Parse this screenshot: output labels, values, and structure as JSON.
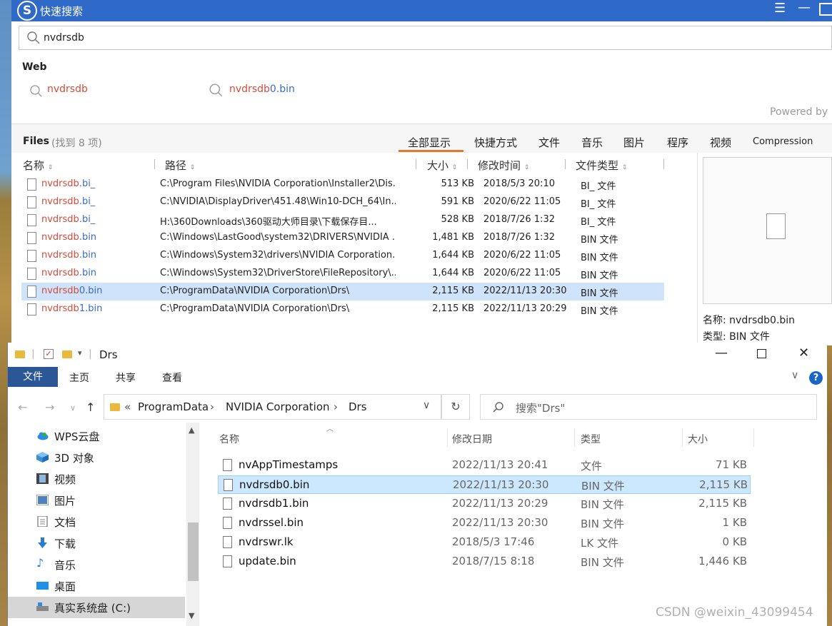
{
  "quick_search": {
    "app_title": "快速搜索",
    "logo_glyph": "S",
    "query": "nvdrsdb",
    "web_label": "Web",
    "web_suggestions": [
      {
        "red": "nvdrsdb",
        "blue": ""
      },
      {
        "red": "nvdrsdb",
        "blue": "0.bin"
      }
    ],
    "powered_by": "Powered by",
    "files_label": "Files",
    "files_count": "(找到 8 项)",
    "tabs": [
      "全部显示",
      "快捷方式",
      "文件",
      "音乐",
      "图片",
      "程序",
      "视频",
      "Compression"
    ],
    "active_tab": "全部显示",
    "columns": {
      "name": "名称",
      "path": "路径",
      "size": "大小",
      "modified": "修改时间",
      "type": "文件类型"
    },
    "results": [
      {
        "name_red": "nvdrsdb",
        "name_blue": ".bi_",
        "path": "C:\\Program Files\\NVIDIA Corporation\\Installer2\\Dis...",
        "size": "513 KB",
        "modified": "2018/5/3 20:10",
        "type": "BI_ 文件",
        "selected": false
      },
      {
        "name_red": "nvdrsdb",
        "name_blue": ".bi_",
        "path": "C:\\NVIDIA\\DisplayDriver\\451.48\\Win10-DCH_64\\In...",
        "size": "591 KB",
        "modified": "2020/6/22 11:05",
        "type": "BI_ 文件",
        "selected": false
      },
      {
        "name_red": "nvdrsdb",
        "name_blue": ".bi_",
        "path": "H:\\360Downloads\\360驱动大师目录\\下载保存目...",
        "size": "528 KB",
        "modified": "2018/7/26 1:32",
        "type": "BI_ 文件",
        "selected": false
      },
      {
        "name_red": "nvdrsdb",
        "name_blue": ".bin",
        "path": "C:\\Windows\\LastGood\\system32\\DRIVERS\\NVIDIA ...",
        "size": "1,481 KB",
        "modified": "2018/7/26 1:32",
        "type": "BIN 文件",
        "selected": false
      },
      {
        "name_red": "nvdrsdb",
        "name_blue": ".bin",
        "path": "C:\\Windows\\System32\\drivers\\NVIDIA Corporation...",
        "size": "1,644 KB",
        "modified": "2020/6/22 11:05",
        "type": "BIN 文件",
        "selected": false
      },
      {
        "name_red": "nvdrsdb",
        "name_blue": ".bin",
        "path": "C:\\Windows\\System32\\DriverStore\\FileRepository\\...",
        "size": "1,644 KB",
        "modified": "2020/6/22 11:05",
        "type": "BIN 文件",
        "selected": false
      },
      {
        "name_red": "nvdrsdb",
        "name_blue": "0.bin",
        "path": "C:\\ProgramData\\NVIDIA Corporation\\Drs\\",
        "size": "2,115 KB",
        "modified": "2022/11/13 20:30",
        "type": "BIN 文件",
        "selected": true
      },
      {
        "name_red": "nvdrsdb",
        "name_blue": "1.bin",
        "path": "C:\\ProgramData\\NVIDIA Corporation\\Drs\\",
        "size": "2,115 KB",
        "modified": "2022/11/13 20:29",
        "type": "BIN 文件",
        "selected": false
      }
    ],
    "preview": {
      "name": "名称: nvdrsdb0.bin",
      "type": "类型: BIN 文件"
    },
    "colors": {
      "titlebar": "#2f6ac8",
      "match": "#d54a3a",
      "rest": "#3a6ac8",
      "selected_row": "#cfe3fa",
      "tab_underline": "#e07a2e"
    }
  },
  "explorer": {
    "title": "Drs",
    "ribbon_tabs": {
      "file": "文件",
      "home": "主页",
      "share": "共享",
      "view": "查看"
    },
    "help": "?",
    "breadcrumb": {
      "prefix": "«",
      "items": [
        "ProgramData",
        "NVIDIA Corporation",
        "Drs"
      ]
    },
    "search_placeholder": "搜索\"Drs\"",
    "nav_items": [
      {
        "label": "WPS云盘",
        "icon": "cloud-icon"
      },
      {
        "label": "3D 对象",
        "icon": "3d-objects-icon"
      },
      {
        "label": "视频",
        "icon": "video-icon"
      },
      {
        "label": "图片",
        "icon": "pictures-icon"
      },
      {
        "label": "文档",
        "icon": "documents-icon"
      },
      {
        "label": "下载",
        "icon": "download-icon"
      },
      {
        "label": "音乐",
        "icon": "music-icon"
      },
      {
        "label": "桌面",
        "icon": "desktop-icon"
      },
      {
        "label": "真实系统盘 (C:)",
        "icon": "drive-icon"
      }
    ],
    "selected_nav": "真实系统盘 (C:)",
    "columns": {
      "name": "名称",
      "modified": "修改日期",
      "type": "类型",
      "size": "大小"
    },
    "files": [
      {
        "name": "nvAppTimestamps",
        "modified": "2022/11/13 20:41",
        "type": "文件",
        "size": "71 KB",
        "selected": false
      },
      {
        "name": "nvdrsdb0.bin",
        "modified": "2022/11/13 20:30",
        "type": "BIN 文件",
        "size": "2,115 KB",
        "selected": true
      },
      {
        "name": "nvdrsdb1.bin",
        "modified": "2022/11/13 20:29",
        "type": "BIN 文件",
        "size": "2,115 KB",
        "selected": false
      },
      {
        "name": "nvdrssel.bin",
        "modified": "2022/11/13 20:30",
        "type": "BIN 文件",
        "size": "1 KB",
        "selected": false
      },
      {
        "name": "nvdrswr.lk",
        "modified": "2018/5/3 17:46",
        "type": "LK 文件",
        "size": "0 KB",
        "selected": false
      },
      {
        "name": "update.bin",
        "modified": "2018/7/15 8:18",
        "type": "BIN 文件",
        "size": "1,446 KB",
        "selected": false
      }
    ],
    "colors": {
      "file_tab": "#2b5797",
      "selected_row": "#cce8ff",
      "help": "#1a66c6"
    }
  },
  "watermark": "CSDN @weixin_43099454"
}
